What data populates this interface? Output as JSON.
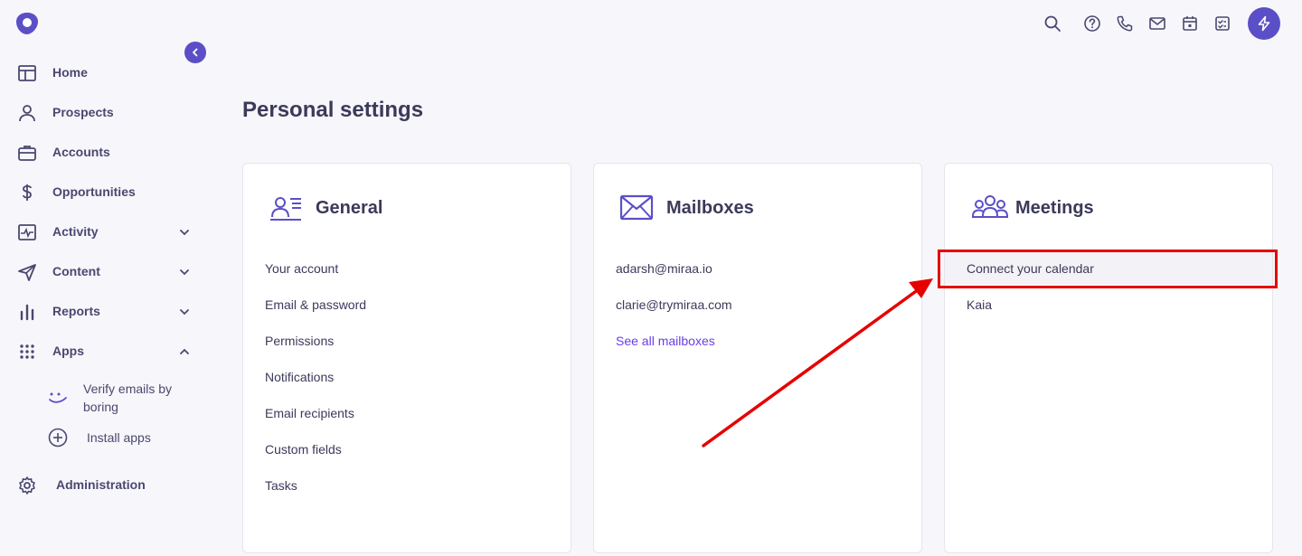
{
  "sidebar": {
    "items": [
      {
        "label": "Home",
        "icon": "home-icon"
      },
      {
        "label": "Prospects",
        "icon": "person-icon"
      },
      {
        "label": "Accounts",
        "icon": "briefcase-icon"
      },
      {
        "label": "Opportunities",
        "icon": "dollar-icon"
      },
      {
        "label": "Activity",
        "icon": "activity-icon",
        "expandable": true
      },
      {
        "label": "Content",
        "icon": "send-icon",
        "expandable": true
      },
      {
        "label": "Reports",
        "icon": "bar-chart-icon",
        "expandable": true
      },
      {
        "label": "Apps",
        "icon": "grid-dots-icon",
        "expanded": true
      }
    ],
    "apps": [
      {
        "label": "Verify emails by boring",
        "icon": "smile-icon"
      },
      {
        "label": "Install apps",
        "icon": "plus-circle-icon"
      }
    ],
    "administration": "Administration"
  },
  "topbar": {
    "icons": [
      "search-icon",
      "help-icon",
      "phone-icon",
      "mail-icon",
      "calendar-icon",
      "tasks-icon",
      "bolt-icon"
    ]
  },
  "page": {
    "title": "Personal settings"
  },
  "cards": {
    "general": {
      "title": "General",
      "links": [
        "Your account",
        "Email & password",
        "Permissions",
        "Notifications",
        "Email recipients",
        "Custom fields",
        "Tasks"
      ]
    },
    "mailboxes": {
      "title": "Mailboxes",
      "links": [
        "adarsh@miraa.io",
        "clarie@trymiraa.com"
      ],
      "see_all": "See all mailboxes"
    },
    "meetings": {
      "title": "Meetings",
      "links": [
        "Connect your calendar",
        "Kaia"
      ]
    }
  },
  "colors": {
    "accent": "#5b4fc7",
    "link": "#6a3de8",
    "annotation": "#e60000"
  }
}
